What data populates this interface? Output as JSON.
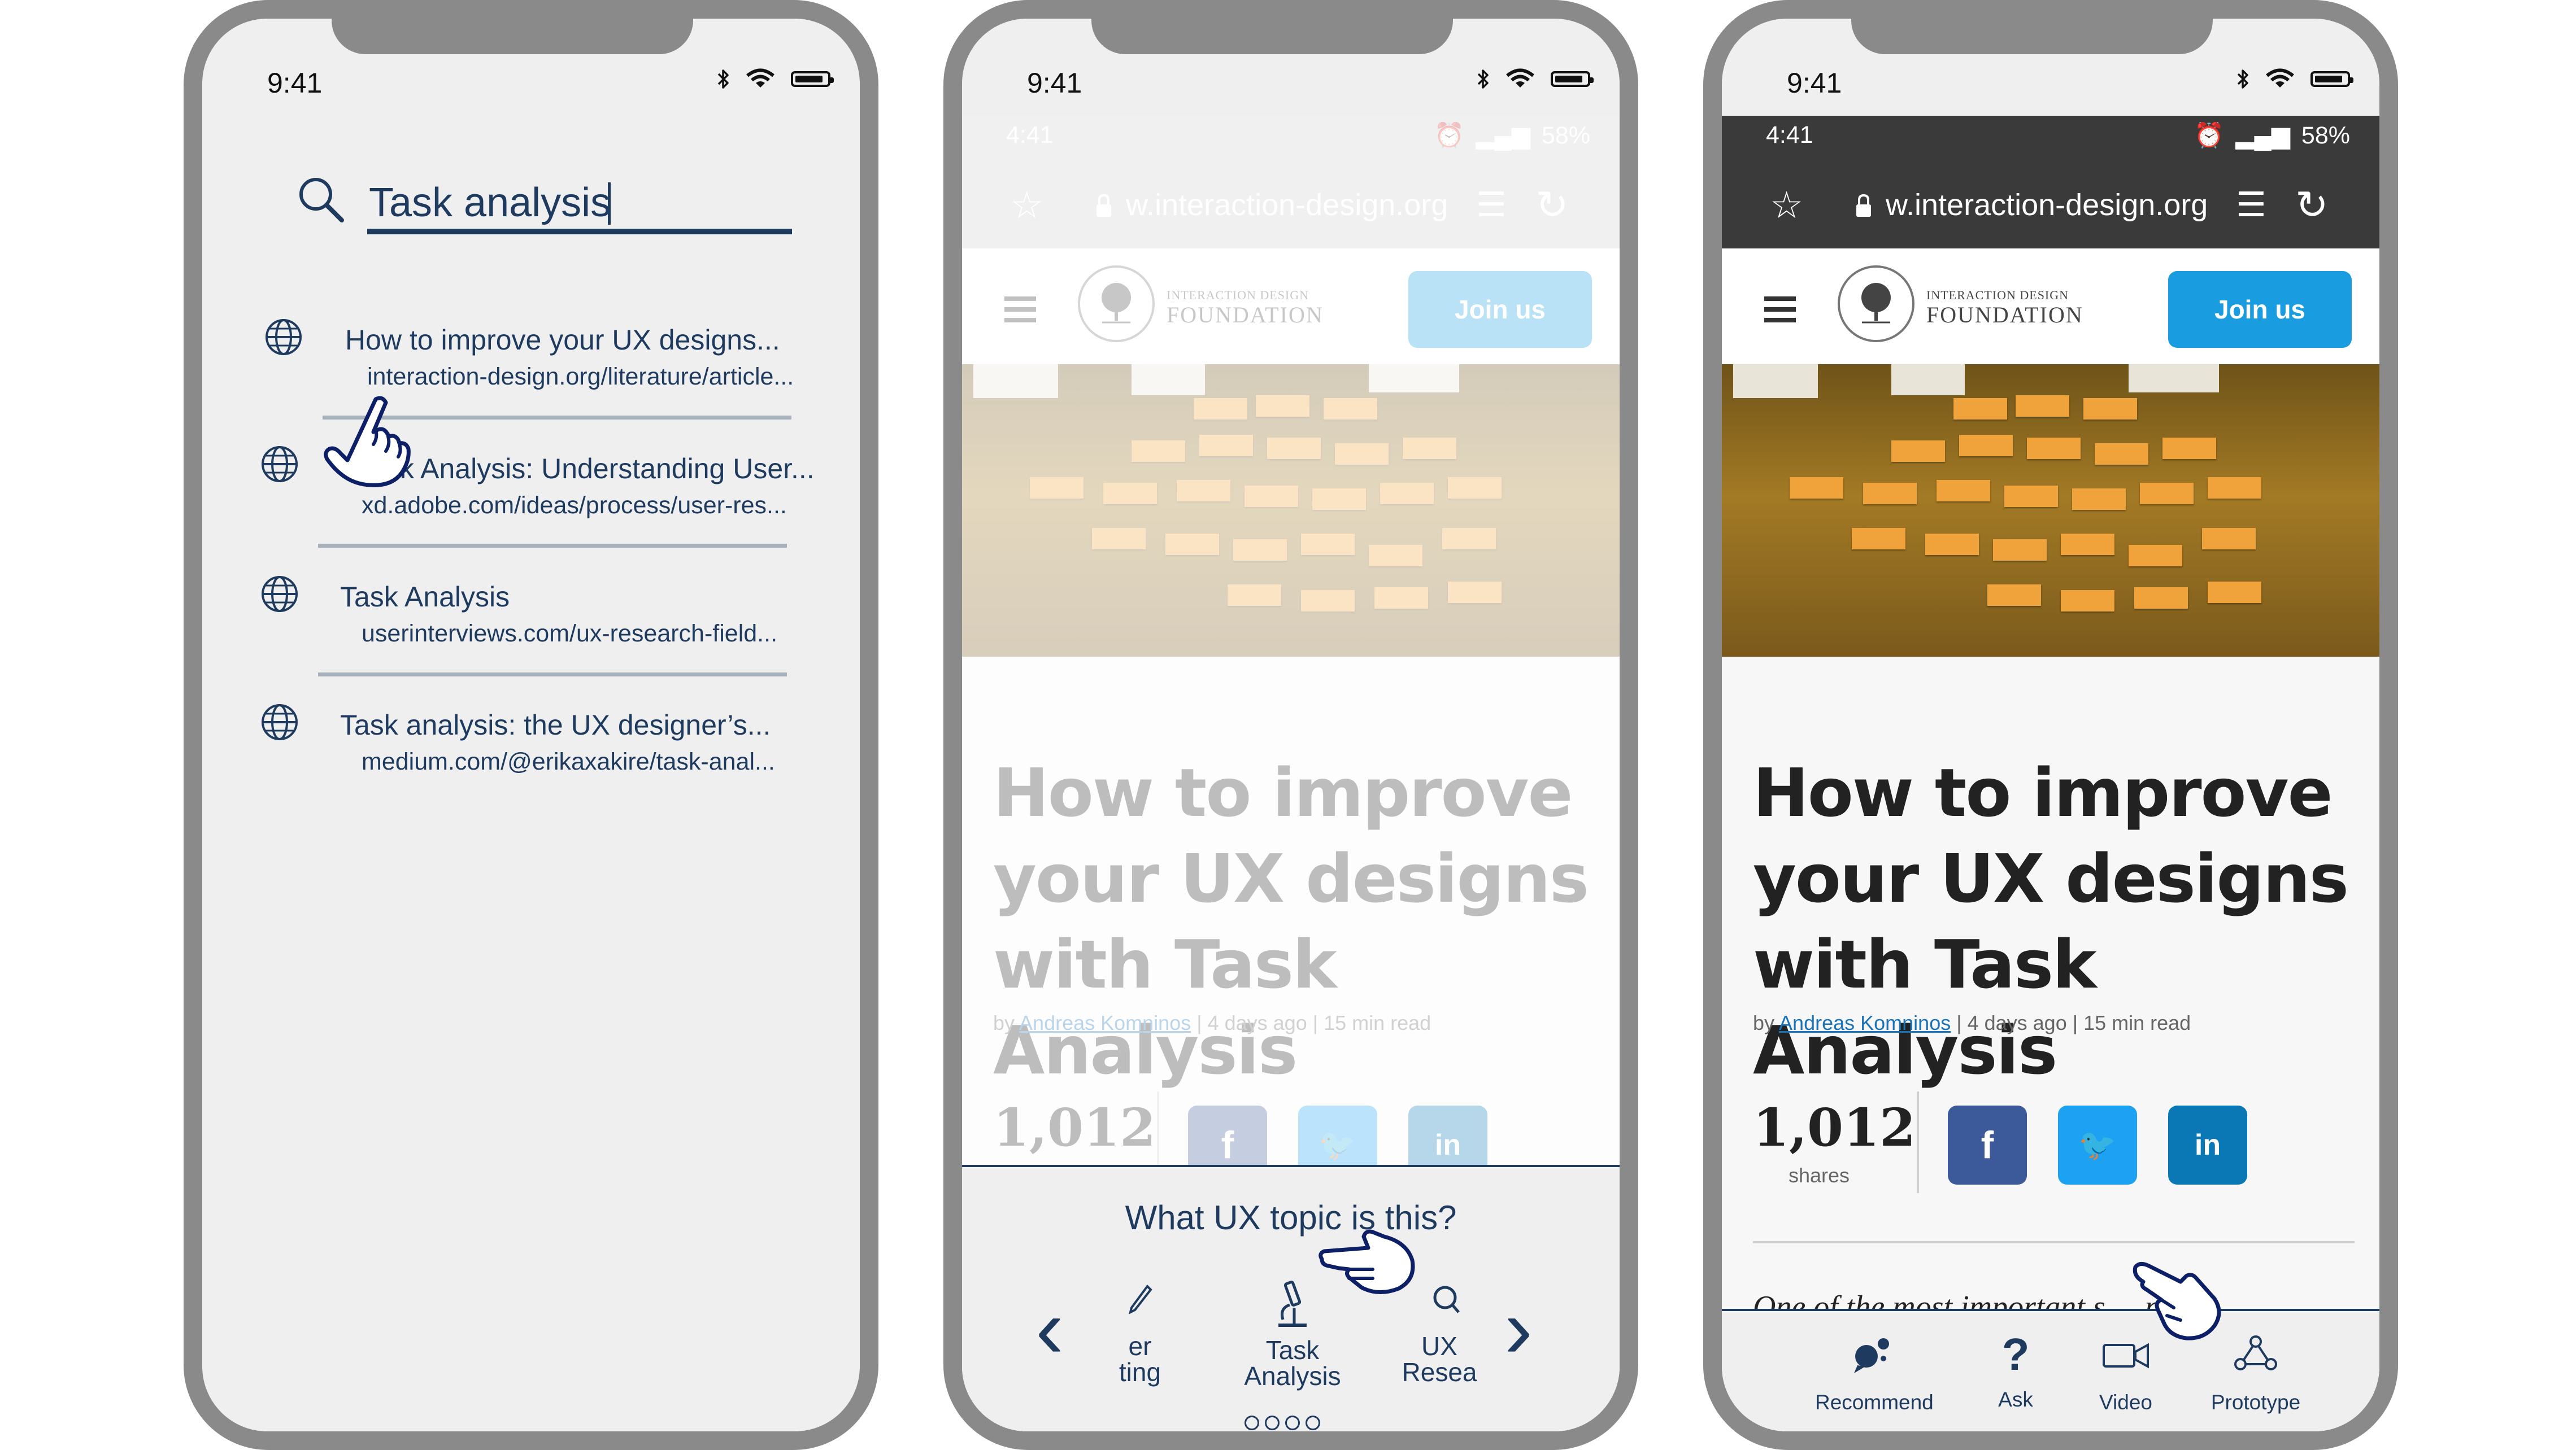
{
  "status_bar": {
    "time": "9:41"
  },
  "search_screen": {
    "query": "Task analysis",
    "results": [
      {
        "title": "How to improve your UX designs...",
        "url": "interaction-design.org/literature/article..."
      },
      {
        "title": "k Analysis: Understanding User...",
        "url": "xd.adobe.com/ideas/process/user-res..."
      },
      {
        "title": "Task Analysis",
        "url": "userinterviews.com/ux-research-field..."
      },
      {
        "title": "Task analysis: the UX designer’s...",
        "url": "medium.com/@erikaxakire/task-anal..."
      }
    ]
  },
  "browser": {
    "android_time": "4:41",
    "battery": "58%",
    "url": "w.interaction-design.org",
    "colors": {
      "chrome": "#3a3a3a",
      "chrome_dimmed": "#cbcbcb",
      "join_button": "#1a9de0",
      "accent_navy": "#1e3a5f"
    }
  },
  "site": {
    "logo_small": "INTERACTION DESIGN",
    "logo_big": "FOUNDATION",
    "join_label": "Join us"
  },
  "article": {
    "title": "How to improve your UX designs with Task Analysis",
    "by": "by",
    "author": "Andreas Komninos",
    "meta": "| 4 days ago | 15 min read",
    "shares_count": "1,012",
    "shares_label": "shares",
    "excerpt_a": "One of the most important s",
    "excerpt_b": "n the"
  },
  "topic_picker": {
    "question": "What UX topic is this?",
    "items": [
      {
        "line1": "er",
        "line2": "ting",
        "icon": "pencil-icon"
      },
      {
        "line1": "Task",
        "line2": "Analysis",
        "icon": "microscope-icon"
      },
      {
        "line1": "UX",
        "line2": "Resea",
        "icon": "magnifier-icon"
      }
    ],
    "page_count": 4
  },
  "bottom_nav": [
    {
      "label": "Recommend",
      "icon": "recommend-icon"
    },
    {
      "label": "Ask",
      "icon": "question-icon"
    },
    {
      "label": "Video",
      "icon": "video-icon"
    },
    {
      "label": "Prototype",
      "icon": "prototype-icon"
    }
  ]
}
